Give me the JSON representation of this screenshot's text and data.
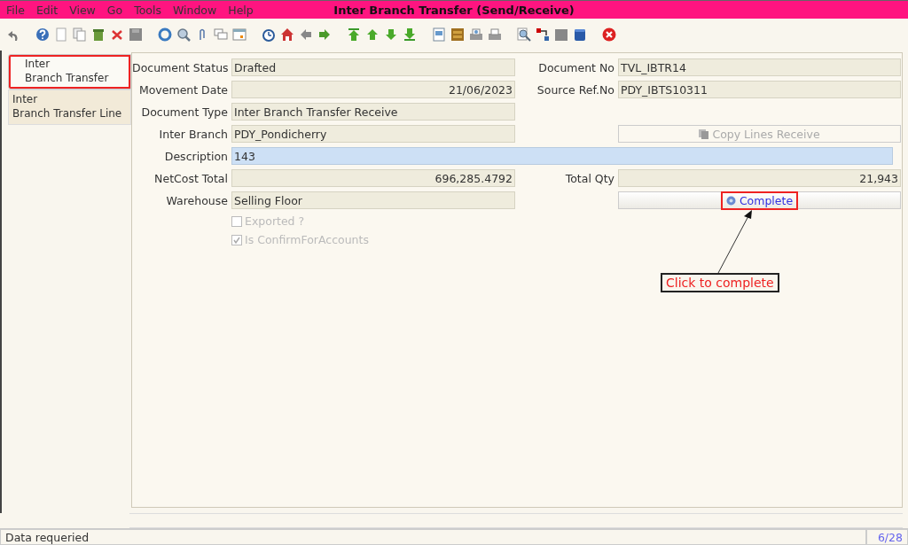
{
  "window": {
    "title": "Inter Branch Transfer (Send/Receive)"
  },
  "menu": [
    {
      "label": "File"
    },
    {
      "label": "Edit"
    },
    {
      "label": "View"
    },
    {
      "label": "Go"
    },
    {
      "label": "Tools"
    },
    {
      "label": "Window"
    },
    {
      "label": "Help"
    }
  ],
  "tabs": [
    {
      "label": "Inter\nBranch Transfer",
      "selected": true,
      "highlighted": true
    },
    {
      "label": "Inter\nBranch Transfer Line",
      "selected": false,
      "highlighted": false
    }
  ],
  "rows": [
    {
      "cells": [
        {
          "kind": "text",
          "label": "Document Status",
          "value": "Drafted"
        },
        {
          "kind": "text",
          "label": "Document No",
          "value": "TVL_IBTR14"
        }
      ]
    },
    {
      "cells": [
        {
          "kind": "number",
          "label": "Movement Date",
          "value": "21/06/2023"
        },
        {
          "kind": "text",
          "label": "Source Ref.No",
          "value": "PDY_IBTS10311"
        }
      ]
    },
    {
      "cells": [
        {
          "kind": "text",
          "label": "Document Type",
          "value": "Inter Branch Transfer Receive"
        }
      ]
    },
    {
      "cells": [
        {
          "kind": "text",
          "label": "Inter Branch",
          "value": "PDY_Pondicherry"
        },
        {
          "kind": "button",
          "label": "Copy Lines Receive",
          "disabled": true,
          "highlighted": false
        }
      ]
    },
    {
      "cells": [
        {
          "kind": "wide",
          "label": "Description",
          "value": "143",
          "focused": true
        }
      ]
    },
    {
      "cells": [
        {
          "kind": "number",
          "label": "NetCost Total",
          "value": "696,285.4792"
        },
        {
          "kind": "number",
          "label": "Total Qty",
          "value": "21,943"
        }
      ]
    },
    {
      "cells": [
        {
          "kind": "text",
          "label": "Warehouse",
          "value": "Selling Floor"
        },
        {
          "kind": "button",
          "label": "Complete",
          "disabled": false,
          "highlighted": true
        }
      ]
    }
  ],
  "checkboxes": [
    {
      "label": "Exported ?",
      "checked": false,
      "disabled": true
    },
    {
      "label": "Is ConfirmForAccounts",
      "checked": true,
      "disabled": true
    }
  ],
  "callout": {
    "text": "Click to complete"
  },
  "status_bar": {
    "message": "Data requeried",
    "counter": "6/28"
  }
}
